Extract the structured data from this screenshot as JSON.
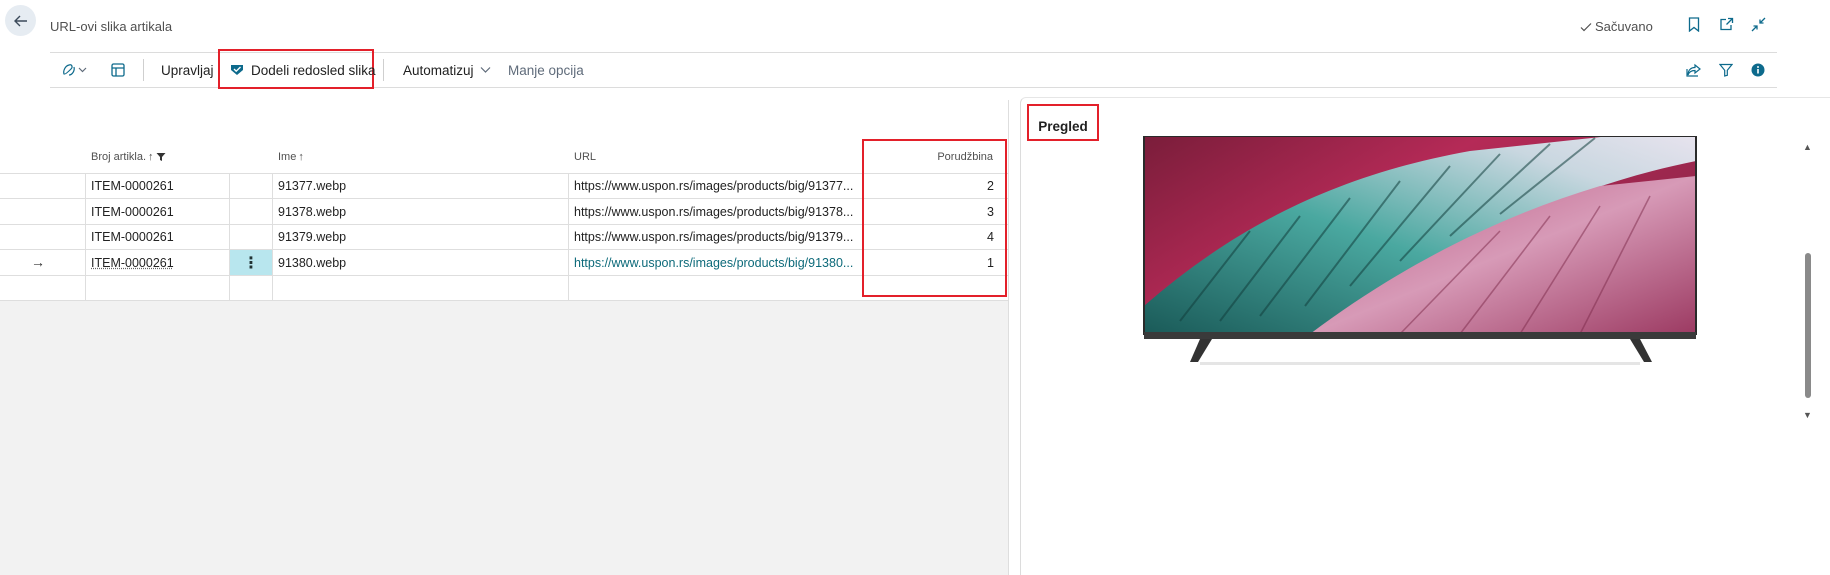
{
  "header": {
    "title": "URL-ovi slika artikala",
    "saved_label": "Sačuvano"
  },
  "actions": {
    "manage": "Upravljaj",
    "assign_order": "Dodeli redosled slika",
    "automate": "Automatizuj",
    "fewer_options": "Manje opcija"
  },
  "grid": {
    "columns": {
      "item_no": "Broj artikla.",
      "name": "Ime",
      "url": "URL",
      "order": "Porudžbina"
    },
    "rows": [
      {
        "item_no": "ITEM-0000261",
        "name": "91377.webp",
        "url": "https://www.uspon.rs/images/products/big/91377...",
        "order": "2"
      },
      {
        "item_no": "ITEM-0000261",
        "name": "91378.webp",
        "url": "https://www.uspon.rs/images/products/big/91378...",
        "order": "3"
      },
      {
        "item_no": "ITEM-0000261",
        "name": "91379.webp",
        "url": "https://www.uspon.rs/images/products/big/91379...",
        "order": "4"
      },
      {
        "item_no": "ITEM-0000261",
        "name": "91380.webp",
        "url": "https://www.uspon.rs/images/products/big/91380...",
        "order": "1"
      }
    ],
    "selected_row_index": 3
  },
  "preview": {
    "title": "Pregled"
  },
  "icons": {
    "back": "arrow-left-icon",
    "saved": "checkmark-icon",
    "bookmark": "bookmark-icon",
    "open_new": "open-in-new-window-icon",
    "collapse": "collapse-icon",
    "copilot": "copilot-icon",
    "layout": "page-layout-icon",
    "assign": "assign-order-icon",
    "share": "share-icon",
    "filter": "filter-icon",
    "info": "info-icon"
  },
  "colors": {
    "accent": "#0d6a8c",
    "highlight": "#e3202a",
    "selected_cell": "#b8e6ee"
  }
}
